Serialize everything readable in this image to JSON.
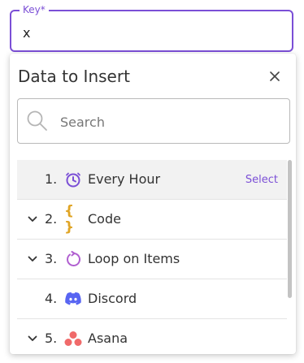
{
  "key_field": {
    "label": "Key*",
    "value": "x"
  },
  "panel": {
    "title": "Data to Insert"
  },
  "search": {
    "placeholder": "Search"
  },
  "items": [
    {
      "number": "1.",
      "label": "Every Hour",
      "icon": "clock-icon",
      "action": "Select",
      "expandable": false
    },
    {
      "number": "2.",
      "label": "Code",
      "icon": "code-braces-icon",
      "braces": "{ }",
      "expandable": true
    },
    {
      "number": "3.",
      "label": "Loop on Items",
      "icon": "loop-icon",
      "expandable": true
    },
    {
      "number": "4.",
      "label": "Discord",
      "icon": "discord-icon",
      "expandable": false
    },
    {
      "number": "5.",
      "label": "Asana",
      "icon": "asana-icon",
      "expandable": true
    }
  ],
  "colors": {
    "accent": "#7b4fd6",
    "code_icon": "#e0a526",
    "loop_icon": "#b05fd0",
    "discord_icon": "#5865f2",
    "asana_icon": "#f06a6a"
  }
}
